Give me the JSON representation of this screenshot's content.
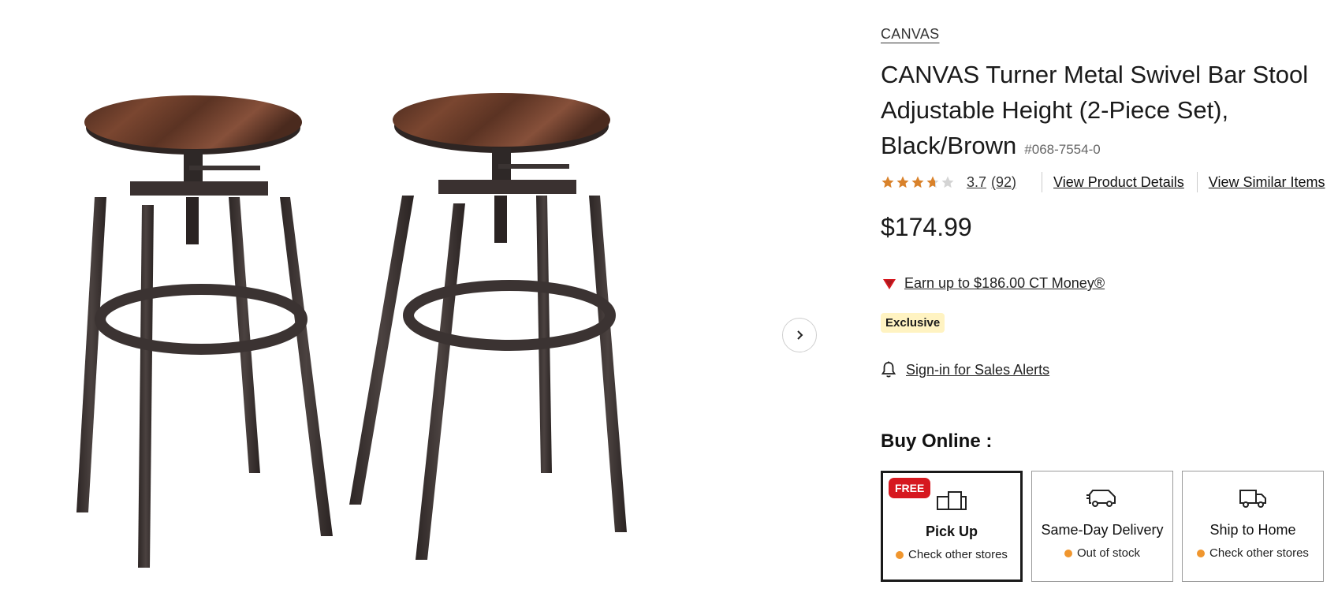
{
  "product": {
    "brand": "CANVAS",
    "title": "CANVAS Turner Metal Swivel Bar Stool Adjustable Height (2-Piece Set), Black/Brown",
    "sku": "#068-7554-0",
    "rating": "3.7",
    "rating_value": 3.7,
    "rating_max": 5,
    "review_count": "(92)",
    "view_details_label": "View Product Details",
    "view_similar_label": "View Similar Items",
    "price": "$174.99",
    "ct_money": "Earn up to $186.00 CT Money®",
    "exclusive_badge": "Exclusive",
    "sales_alerts": "Sign-in for Sales Alerts"
  },
  "buy_online": {
    "heading": "Buy Online :",
    "options": [
      {
        "label": "Pick Up",
        "status": "Check other stores",
        "badge": "FREE",
        "selected": true,
        "icon": "pickup-icon"
      },
      {
        "label": "Same-Day Delivery",
        "status": "Out of stock",
        "selected": false,
        "icon": "delivery-van-icon"
      },
      {
        "label": "Ship to Home",
        "status": "Check other stores",
        "selected": false,
        "icon": "shipping-truck-icon"
      }
    ]
  },
  "colors": {
    "star": "#d9822b",
    "free_badge": "#d6181f",
    "exclusive_bg": "#fff3c2",
    "status_dot": "#f0962e",
    "ct_red": "#d6181f"
  }
}
